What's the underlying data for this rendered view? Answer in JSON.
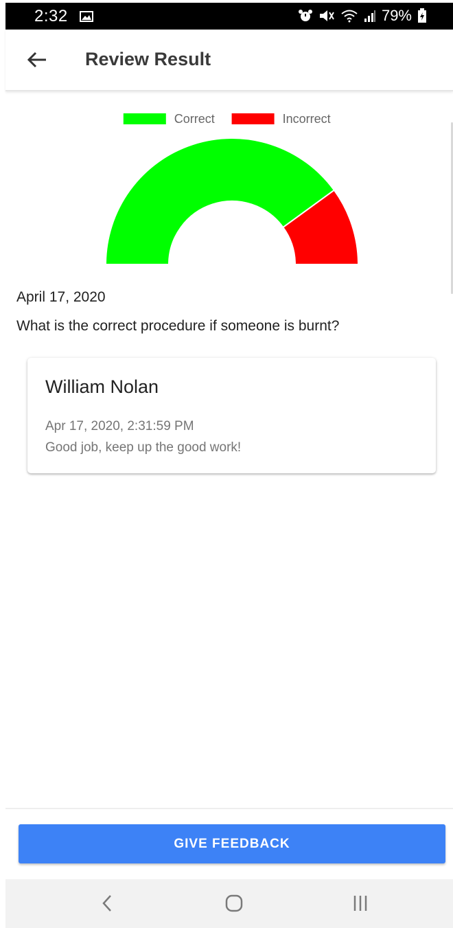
{
  "status_bar": {
    "time": "2:32",
    "battery": "79%",
    "icons": [
      "image-icon",
      "alarm-icon",
      "mute-icon",
      "wifi-icon",
      "signal-icon",
      "battery-icon"
    ]
  },
  "app_bar": {
    "title": "Review Result",
    "back_icon": "arrow-left-icon"
  },
  "chart_data": {
    "type": "pie",
    "variant": "half-doughnut",
    "categories": [
      "Correct",
      "Incorrect"
    ],
    "values": [
      80,
      20
    ],
    "colors": [
      "#00ff00",
      "#ff0000"
    ],
    "legend": [
      "Correct",
      "Incorrect"
    ],
    "legend_position": "top"
  },
  "review": {
    "date": "April 17, 2020",
    "question": "What is the correct procedure if someone is burnt?"
  },
  "feedback": [
    {
      "author": "William Nolan",
      "timestamp": "Apr 17, 2020, 2:31:59 PM",
      "message": "Good job, keep up the good work!"
    }
  ],
  "actions": {
    "give_feedback_label": "GIVE FEEDBACK"
  },
  "nav_bar": {
    "icons": [
      "nav-back-icon",
      "nav-home-icon",
      "nav-recents-icon"
    ]
  },
  "colors": {
    "primary": "#3d82f6",
    "correct": "#00ff00",
    "incorrect": "#ff0000"
  }
}
